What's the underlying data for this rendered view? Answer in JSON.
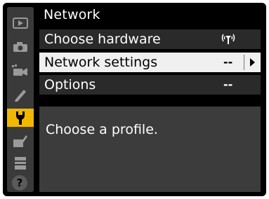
{
  "menu": {
    "title": "Network",
    "items": [
      {
        "label": "Choose hardware",
        "value_icon": "wireless-icon"
      },
      {
        "label": "Network settings",
        "value": "--",
        "selected": true
      },
      {
        "label": "Options",
        "value": "--"
      }
    ]
  },
  "help": {
    "text": "Choose a profile.",
    "button": "?"
  },
  "sidebar": {
    "tabs": [
      "playback-icon",
      "camera-icon",
      "movie-icon",
      "pencil-icon",
      "wrench-icon",
      "retouch-icon",
      "my-menu-icon"
    ],
    "active": "wrench-icon"
  },
  "colors": {
    "active_tab": "#f2b800",
    "selected_row": "#f0f0f0",
    "background": "#000000"
  }
}
